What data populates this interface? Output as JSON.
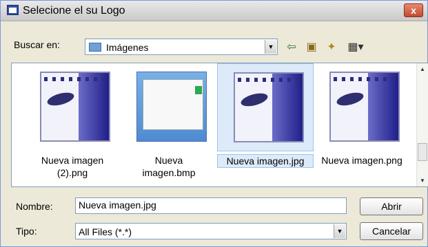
{
  "window": {
    "title": "Selecione el su Logo",
    "close_label": "x"
  },
  "lookin": {
    "label": "Buscar en:",
    "value": "Imágenes"
  },
  "toolbar": {
    "icons": [
      "back-arrow-icon",
      "up-folder-icon",
      "new-folder-icon",
      "view-menu-icon"
    ]
  },
  "files": [
    {
      "name_line1": "Nueva imagen",
      "name_line2": "(2).png",
      "selected": false
    },
    {
      "name_line1": "Nueva",
      "name_line2": "imagen.bmp",
      "selected": false
    },
    {
      "name_line1": "Nueva imagen.jpg",
      "name_line2": "",
      "selected": true
    },
    {
      "name_line1": "Nueva imagen.png",
      "name_line2": "",
      "selected": false
    }
  ],
  "filename": {
    "label": "Nombre:",
    "value": "Nueva imagen.jpg"
  },
  "filetype": {
    "label": "Tipo:",
    "value": "All Files (*.*)"
  },
  "buttons": {
    "open": "Abrir",
    "cancel": "Cancelar"
  }
}
